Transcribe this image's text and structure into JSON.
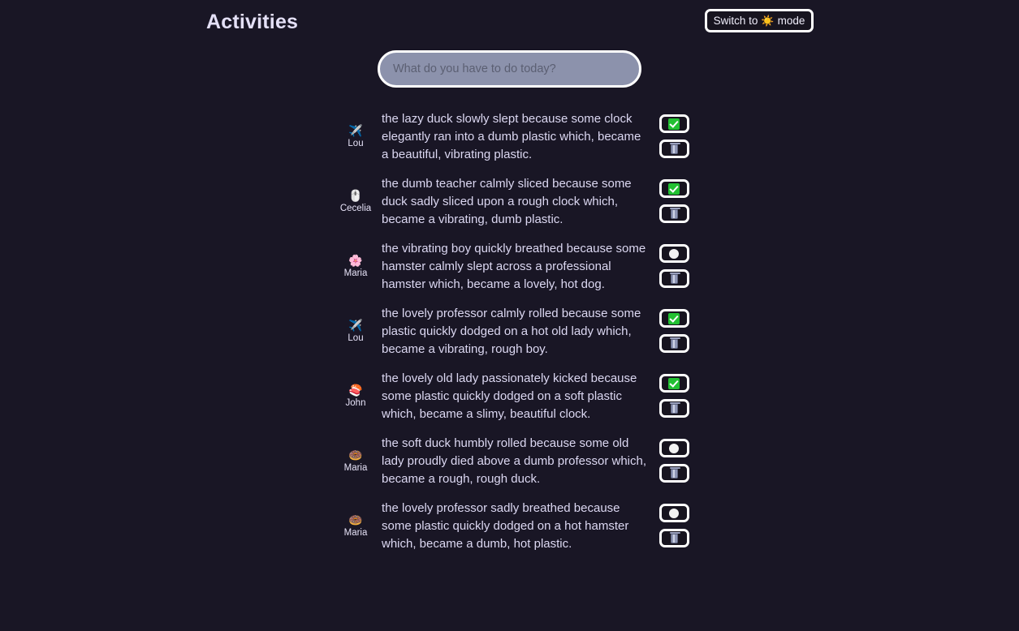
{
  "header": {
    "title": "Activities",
    "mode_switch": {
      "prefix": "Switch to",
      "emoji": "☀️",
      "emoji_name": "sun-emoji",
      "suffix": "mode"
    }
  },
  "input": {
    "placeholder": "What do you have to do today?",
    "value": ""
  },
  "colors": {
    "background": "#191625",
    "title": "#e4e0f7",
    "text": "#dcd8f2",
    "border": "#ffffff",
    "input_fill": "#8c92ac",
    "done_green": "#22c032"
  },
  "icons": {
    "done": "checkmark-green",
    "open": "white-circle",
    "delete": "trash-can"
  },
  "tasks": [
    {
      "avatar_emoji": "✈️",
      "avatar_name": "Lou",
      "text": "the lazy duck slowly slept because some clock elegantly ran into a dumb plastic which, became a beautiful, vibrating plastic.",
      "done": true
    },
    {
      "avatar_emoji": "🖱️",
      "avatar_name": "Cecelia",
      "text": "the dumb teacher calmly sliced because some duck sadly sliced upon a rough clock which, became a vibrating, dumb plastic.",
      "done": true
    },
    {
      "avatar_emoji": "🌸",
      "avatar_name": "Maria",
      "text": "the vibrating boy quickly breathed because some hamster calmly slept across a professional hamster which, became a lovely, hot dog.",
      "done": false
    },
    {
      "avatar_emoji": "✈️",
      "avatar_name": "Lou",
      "text": "the lovely professor calmly rolled because some plastic quickly dodged on a hot old lady which, became a vibrating, rough boy.",
      "done": true
    },
    {
      "avatar_emoji": "🍣",
      "avatar_name": "John",
      "text": "the lovely old lady passionately kicked because some plastic quickly dodged on a soft plastic which, became a slimy, beautiful clock.",
      "done": true
    },
    {
      "avatar_emoji": "🍩",
      "avatar_name": "Maria",
      "text": "the soft duck humbly rolled because some old lady proudly died above a dumb professor which, became a rough, rough duck.",
      "done": false
    },
    {
      "avatar_emoji": "🍩",
      "avatar_name": "Maria",
      "text": "the lovely professor sadly breathed because some plastic quickly dodged on a hot hamster which, became a dumb, hot plastic.",
      "done": false
    }
  ]
}
